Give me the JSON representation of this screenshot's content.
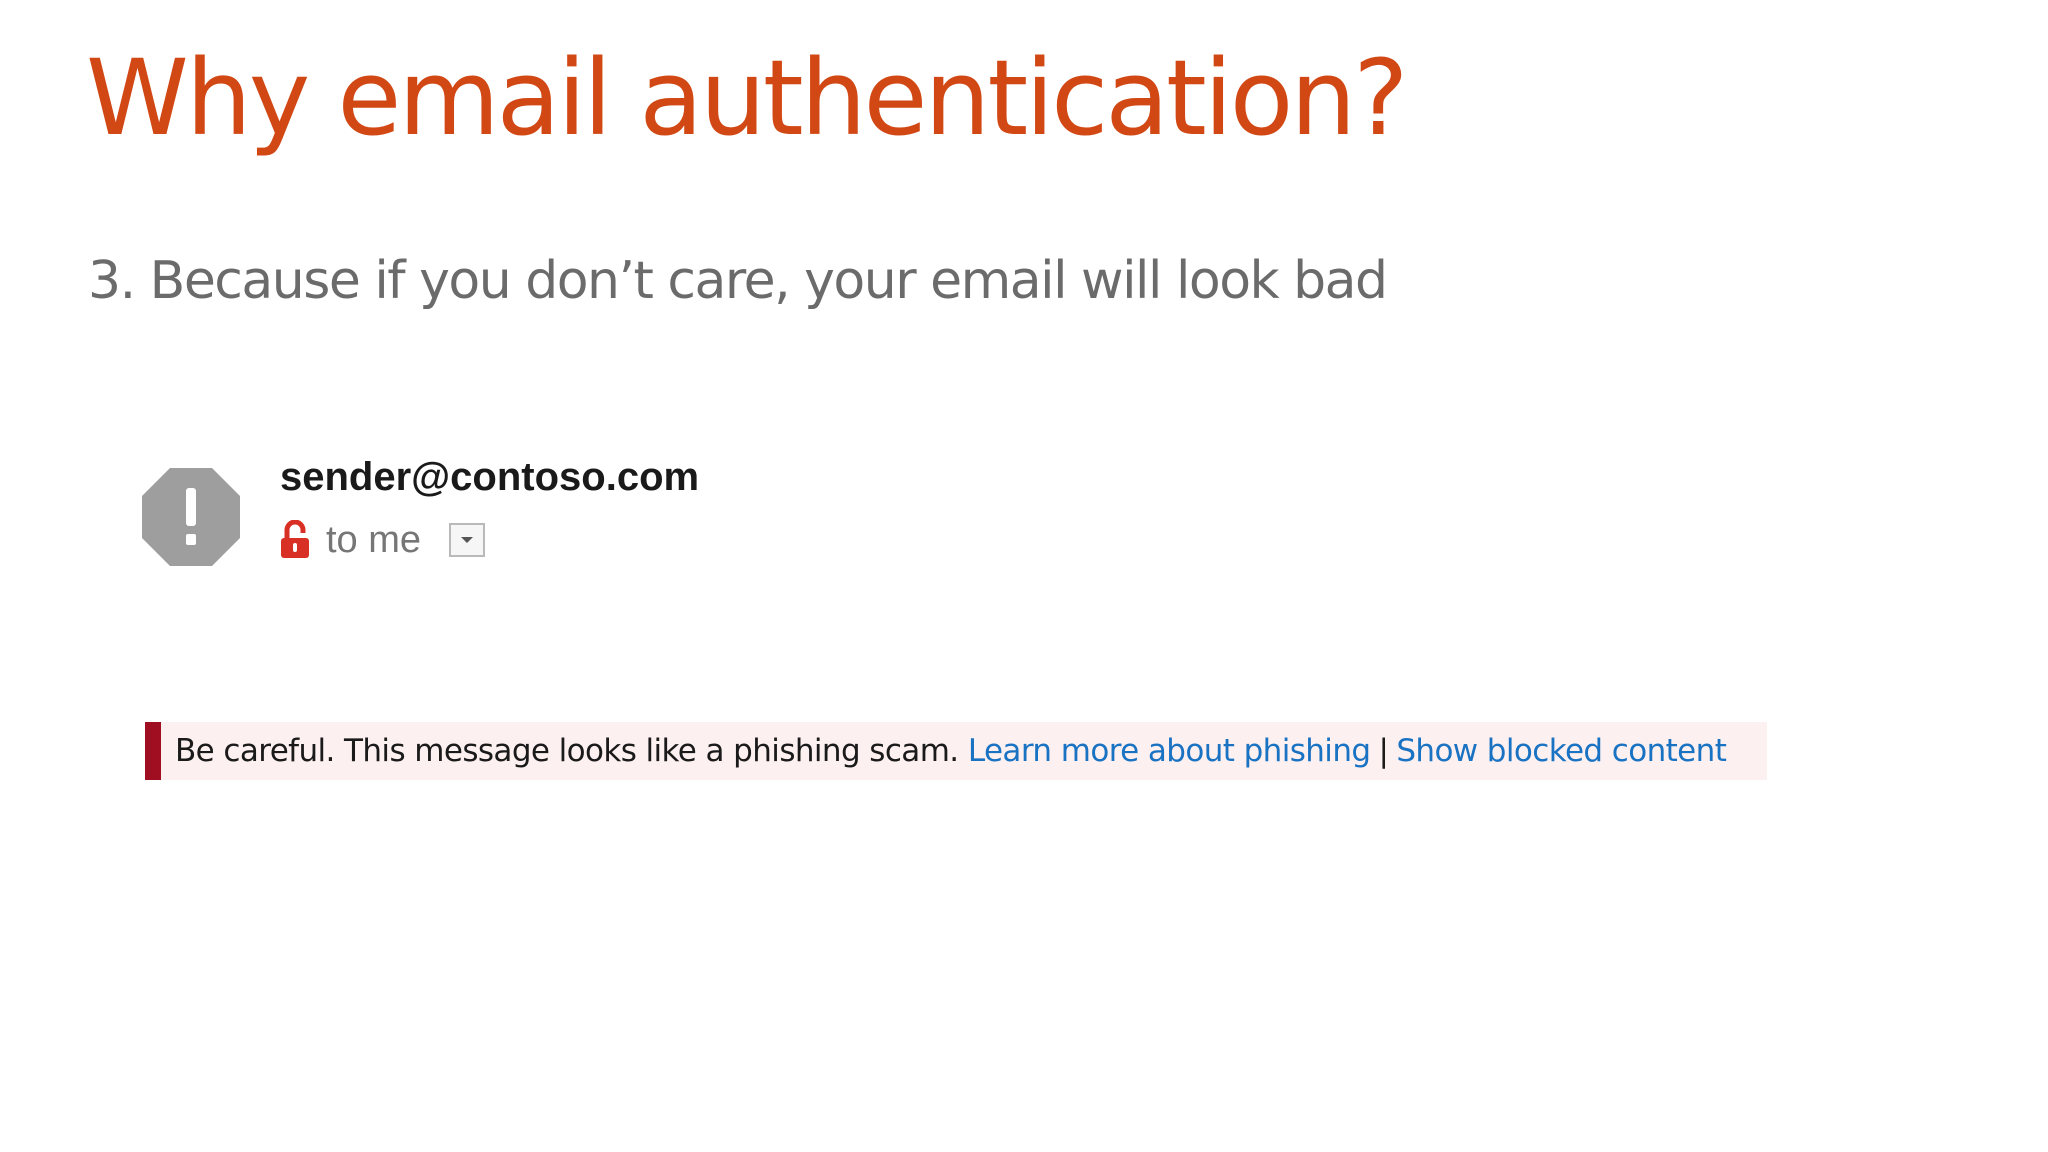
{
  "slide": {
    "title": "Why email authentication?",
    "subtitle": "3. Because if you don’t care, your email will look bad"
  },
  "email": {
    "sender": "sender@contoso.com",
    "recipient": "to me",
    "avatar_icon": "warning-octagon-icon",
    "lock_icon": "unlocked-padlock-icon",
    "dropdown_icon": "chevron-down-icon"
  },
  "banner": {
    "message": "Be careful. This message looks like a phishing scam.",
    "learn_more_link": "Learn more about phishing",
    "separator": "|",
    "show_blocked_link": "Show blocked content"
  },
  "colors": {
    "title": "#d24815",
    "subtitle": "#6b6b6b",
    "avatar": "#9e9e9e",
    "lock": "#d93025",
    "banner_background": "#fdf0f1",
    "banner_accent": "#a00e22",
    "link": "#1a73c2"
  }
}
